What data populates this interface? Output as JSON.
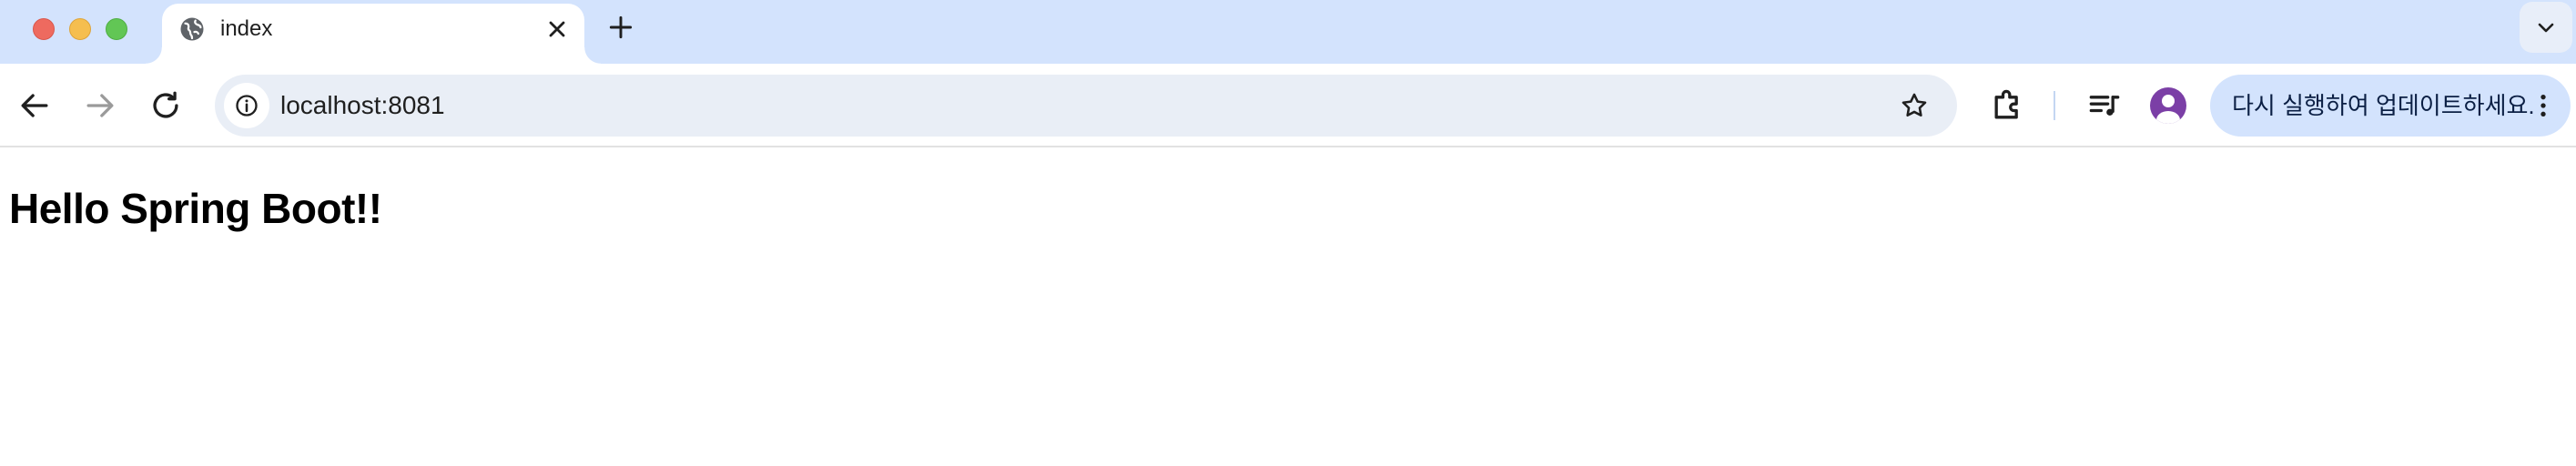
{
  "browser": {
    "tab": {
      "title": "index",
      "favicon": "globe-icon"
    },
    "address_bar": {
      "url": "localhost:8081"
    },
    "update_chip": {
      "label": "다시 실행하여 업데이트하세요."
    },
    "icons": {
      "back": "arrow-left-icon",
      "forward": "arrow-right-icon",
      "reload": "reload-icon",
      "site_info": "info-icon",
      "bookmark": "star-icon",
      "extensions": "puzzle-icon",
      "media": "playlist-music-icon",
      "menu": "kebab-menu-icon",
      "tab_search": "chevron-down-icon",
      "new_tab": "plus-icon",
      "close_tab": "close-icon"
    },
    "colors": {
      "tabstrip": "#d3e3fd",
      "omnibox": "#e9eef6",
      "avatar": "#7b3fa6",
      "traffic_close": "#ee6a5f",
      "traffic_minimize": "#f5be4f",
      "traffic_maximize": "#62c655"
    }
  },
  "page": {
    "heading": "Hello Spring Boot!!"
  }
}
